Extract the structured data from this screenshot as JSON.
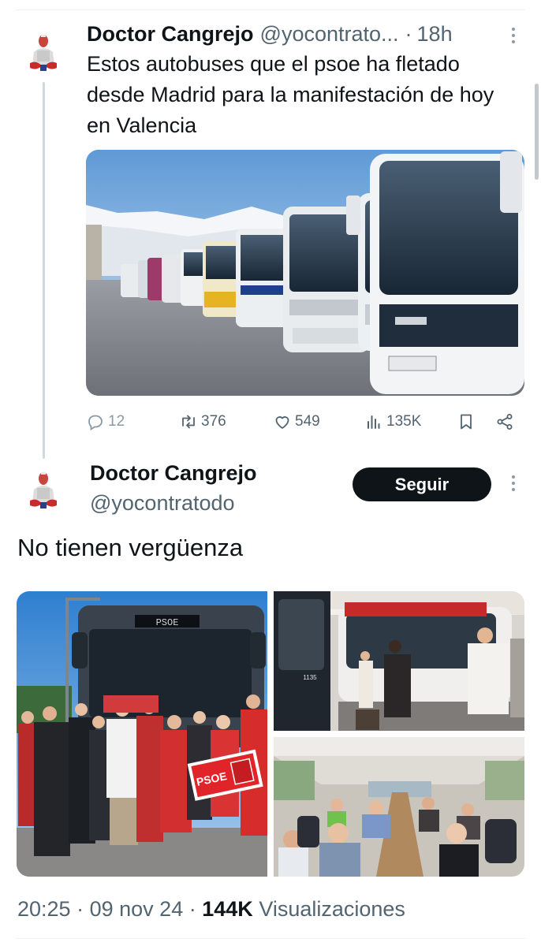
{
  "reply_tweet": {
    "author_name": "Doctor Cangrejo",
    "author_handle": "@yocontrato...",
    "separator": "·",
    "time": "18h",
    "text": "Estos autobuses que el psoe ha fletado desde Madrid para la manifestación de hoy en Valencia",
    "image_icon": "bus-photo",
    "counts": {
      "replies": "12",
      "retweets": "376",
      "likes": "549",
      "views": "135K"
    }
  },
  "main_tweet": {
    "author_name": "Doctor Cangrejo",
    "author_handle": "@yocontratodo",
    "follow_label": "Seguir",
    "text": "No tienen vergüenza",
    "photos": {
      "left": {
        "bus_sign": "PSOE",
        "banner": "PSOE"
      },
      "top_right": {
        "bus_number": "1135"
      },
      "bottom_right": {}
    },
    "time": "20:25",
    "date": "09 nov 24",
    "separator": "·",
    "views_count": "144K",
    "views_label": "Visualizaciones"
  },
  "icons": [
    "reply-icon",
    "retweet-icon",
    "like-icon",
    "views-icon",
    "bookmark-icon",
    "share-icon",
    "more-icon"
  ],
  "colors": {
    "text": "#0f1419",
    "secondary": "#536471",
    "follow_bg": "#0f1419",
    "thread_line": "#cfd9de"
  }
}
